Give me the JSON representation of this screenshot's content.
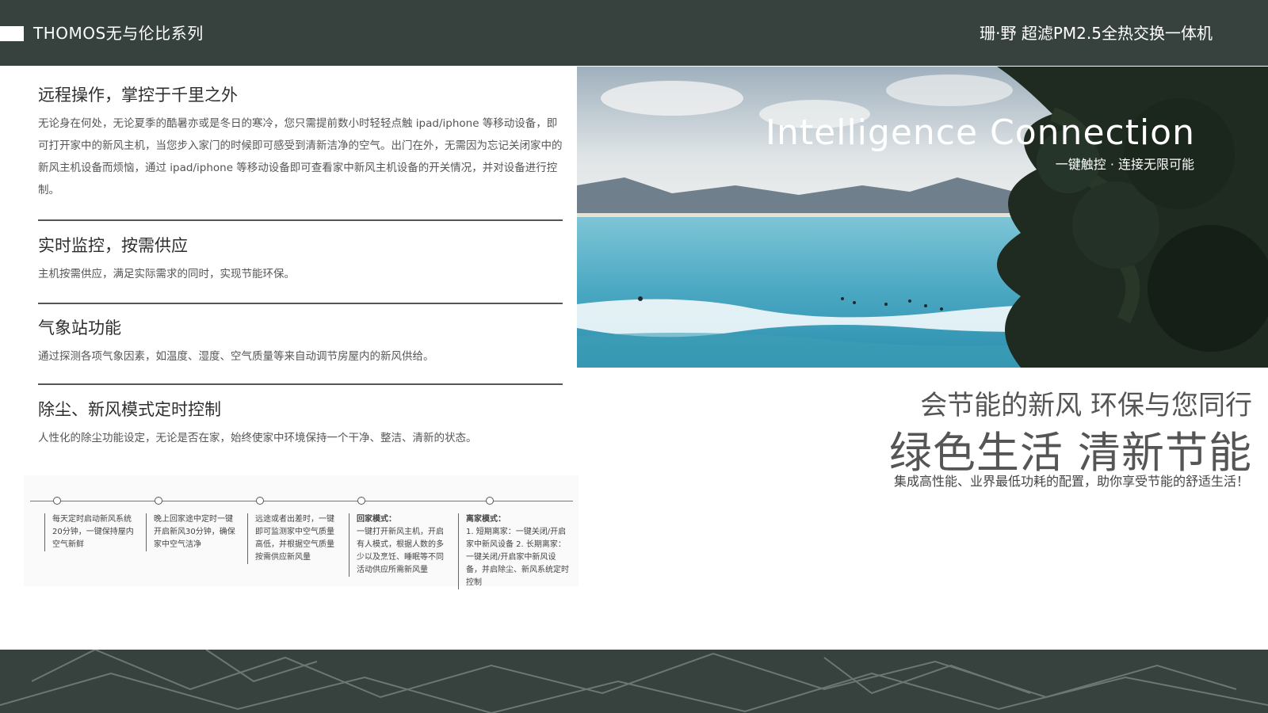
{
  "header": {
    "brand": "THOMOS无与伦比系列",
    "product": "珊·野  超滤PM2.5全热交换一体机"
  },
  "sections": [
    {
      "title": "远程操作，掌控于千里之外",
      "body": "无论身在何处，无论夏季的酷暑亦或是冬日的寒冷，您只需提前数小时轻轻点触 ipad/iphone 等移动设备，即可打开家中的新风主机，当您步入家门的时候即可感受到清新洁净的空气。出门在外，无需因为忘记关闭家中的新风主机设备而烦恼，通过 ipad/iphone 等移动设备即可查看家中新风主机设备的开关情况，并对设备进行控制。"
    },
    {
      "title": "实时监控，按需供应",
      "body": "主机按需供应，满足实际需求的同时，实现节能环保。"
    },
    {
      "title": "气象站功能",
      "body": "通过探测各项气象因素，如温度、湿度、空气质量等来自动调节房屋内的新风供给。"
    },
    {
      "title": "除尘、新风模式定时控制",
      "body": "人性化的除尘功能设定，无论是否在家，始终使家中环境保持一个干净、整洁、清新的状态。"
    }
  ],
  "timeline": [
    {
      "text": "每天定时启动新风系统20分钟，一键保持屋内空气新鲜"
    },
    {
      "text": "晚上回家途中定时一键开启新风30分钟，确保家中空气洁净"
    },
    {
      "text": "远途或者出差时，一键即可监测家中空气质量高低，并根据空气质量按需供应新风量"
    },
    {
      "heading": "回家模式：",
      "text": "一键打开新风主机，开启有人模式，根据人数的多少以及烹饪、睡眠等不同活动供应所需新风量"
    },
    {
      "heading": "离家模式：",
      "text": "1. 短期离家：一键关闭/开启家中新风设备 2. 长期离家：一键关闭/开启家中新风设备，并启除尘、新风系统定时控制"
    }
  ],
  "photo": {
    "title": "Intelligence Connection",
    "subtitle": "一键触控 · 连接无限可能"
  },
  "slogans": {
    "line1": "会节能的新风 环保与您同行",
    "line2": "绿色生活 清新节能",
    "line3": "集成高性能、业界最低功耗的配置，助你享受节能的舒适生活！"
  },
  "colors": {
    "header_bg": "#37423e",
    "footer_bg": "#37423e",
    "text_dark": "#333333"
  }
}
